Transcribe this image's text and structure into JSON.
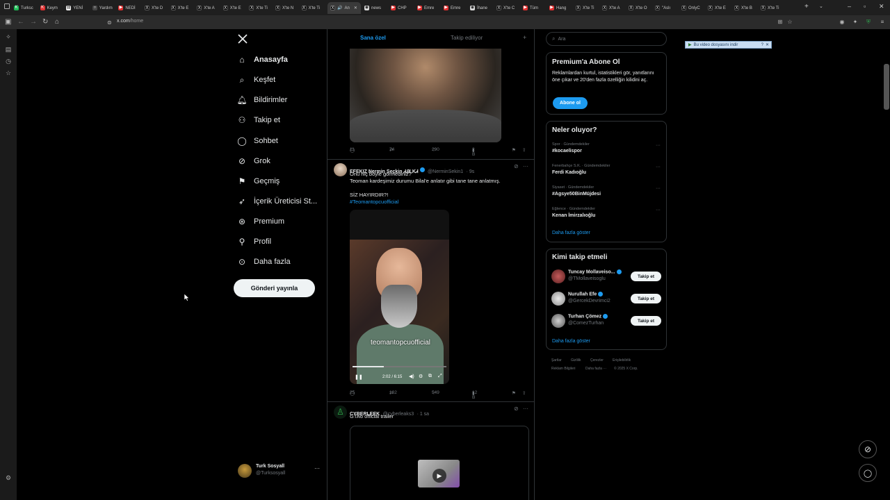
{
  "browser": {
    "tabs": [
      {
        "label": "Turksc",
        "color": "#1db954",
        "glyph": "K"
      },
      {
        "label": "Keym",
        "color": "#e03030",
        "glyph": "K"
      },
      {
        "label": "YENİ",
        "color": "#ffffff",
        "glyph": "▤"
      },
      {
        "label": "Yardım",
        "color": "#444444",
        "glyph": "○"
      },
      {
        "label": "NEDİ",
        "color": "#e03030",
        "glyph": "▶"
      },
      {
        "label": "X'te D",
        "color": "#000000",
        "glyph": "X"
      },
      {
        "label": "X'te E",
        "color": "#000000",
        "glyph": "X"
      },
      {
        "label": "X'te A",
        "color": "#000000",
        "glyph": "X"
      },
      {
        "label": "X'te E",
        "color": "#000000",
        "glyph": "X"
      },
      {
        "label": "X'te Ti",
        "color": "#000000",
        "glyph": "X"
      },
      {
        "label": "X'te N",
        "color": "#000000",
        "glyph": "X"
      },
      {
        "label": "X'te Ti",
        "color": "#000000",
        "glyph": "X"
      }
    ],
    "active_tab": "An",
    "tabs_right": [
      {
        "label": "news",
        "color": "#dddddd",
        "glyph": "◉"
      },
      {
        "label": "CHP",
        "color": "#e03030",
        "glyph": "▶"
      },
      {
        "label": "Emre",
        "color": "#e03030",
        "glyph": "▶"
      },
      {
        "label": "Emre",
        "color": "#e03030",
        "glyph": "▶"
      },
      {
        "label": "İhane",
        "color": "#dddddd",
        "glyph": "◉"
      },
      {
        "label": "X'te C",
        "color": "#000000",
        "glyph": "X"
      },
      {
        "label": "Tüm",
        "color": "#e03030",
        "glyph": "▶"
      },
      {
        "label": "Hang",
        "color": "#e03030",
        "glyph": "▶"
      },
      {
        "label": "X'te Ti",
        "color": "#000000",
        "glyph": "X"
      },
      {
        "label": "X'te A",
        "color": "#000000",
        "glyph": "X"
      },
      {
        "label": "X'te O",
        "color": "#000000",
        "glyph": "X"
      },
      {
        "label": "\"Aslı",
        "color": "#000000",
        "glyph": "X"
      },
      {
        "label": "OnlyC",
        "color": "#000000",
        "glyph": "X"
      },
      {
        "label": "X'te E",
        "color": "#000000",
        "glyph": "X"
      },
      {
        "label": "X'te B",
        "color": "#000000",
        "glyph": "X"
      },
      {
        "label": "X'te Ti",
        "color": "#000000",
        "glyph": "X"
      }
    ],
    "url_domain": "x.com",
    "url_path": "/home"
  },
  "download_bar": "Bu video dosyasını indir",
  "nav": {
    "items": [
      {
        "label": "Anasayfa",
        "icon": "home-icon"
      },
      {
        "label": "Keşfet",
        "icon": "search-icon"
      },
      {
        "label": "Bildirimler",
        "icon": "bell-icon"
      },
      {
        "label": "Takip et",
        "icon": "follow-icon"
      },
      {
        "label": "Sohbet",
        "icon": "chat-icon"
      },
      {
        "label": "Grok",
        "icon": "grok-icon"
      },
      {
        "label": "Geçmiş",
        "icon": "bookmark-icon"
      },
      {
        "label": "İçerik Üreticisi St...",
        "icon": "rocket-icon"
      },
      {
        "label": "Premium",
        "icon": "premium-icon"
      },
      {
        "label": "Profil",
        "icon": "profile-icon"
      },
      {
        "label": "Daha fazla",
        "icon": "more-circle-icon"
      }
    ],
    "post_button": "Gönderi yayınla",
    "account_name": "Turk Sosyall",
    "account_handle": "@Turksosyall"
  },
  "feed": {
    "tab_for_you": "Sana özel",
    "tab_following": "Takip ediliyor",
    "first_actions": {
      "replies": "11",
      "reposts": "74",
      "likes": "290",
      "views": "2 B"
    },
    "tweet2": {
      "name": "EFEKIZ Nermin Seçkin ᏗᎯᏞᏦᏗ",
      "handle": "@NerminSekin1",
      "time": "· 9s",
      "line1": "Onu hiç böyle görmediniz?",
      "line2": "Teoman kardeşimiz durumu Bilal'e anlatır gibi tane tane anlatmış.",
      "line3": "SİZ HAYIRDIR?!",
      "hashtag": "#Teomantopcuofficial",
      "video_watermark": "teomantopcuofficial",
      "video_time": "2:02 / 6:15",
      "video_progress": 0.33,
      "actions": {
        "replies": "25",
        "reposts": "132",
        "likes": "549",
        "views": "12 B"
      }
    },
    "tweet3": {
      "name": "CYBERLEEK",
      "handle": "@cyberleaks3",
      "time": "· 1 sa",
      "text": "GTA6 official trailer"
    }
  },
  "right": {
    "search_placeholder": "Ara",
    "premium": {
      "title": "Premium'a Abone Ol",
      "text": "Reklamlardan kurtul, istatistikleri gör, yanıtlarını öne çıkar ve 20'den fazla özelliğin kilidini aç.",
      "button": "Abone ol"
    },
    "trends": {
      "title": "Neler oluyor?",
      "items": [
        {
          "meta": "Spor · Gündemdekiler",
          "name": "#kocaelispor"
        },
        {
          "meta": "Fenerbahçe S.K. · Gündemdekiler",
          "name": "Ferdi Kadıoğlu"
        },
        {
          "meta": "Siyaset · Gündemdekiler",
          "name": "#Agsye50BinMüjdesi"
        },
        {
          "meta": "Eğlence · Gündemdekiler",
          "name": "Kenan İmirzalıoğlu"
        }
      ],
      "show_more": "Daha fazla göster"
    },
    "who_to_follow": {
      "title": "Kimi takip etmeli",
      "items": [
        {
          "name": "Tuncay Mollaveiso...",
          "handle": "@TMollaveisoglu",
          "button": "Takip et"
        },
        {
          "name": "Nurullah Efe",
          "handle": "@GercekDevrimci2",
          "button": "Takip et"
        },
        {
          "name": "Turhan Çömez",
          "handle": "@ComezTurhan",
          "button": "Takip et"
        }
      ],
      "show_more": "Daha fazla göster"
    },
    "footer": [
      "Şartlar",
      "Gizlilik",
      "Çerezler",
      "Erişilebilirlik",
      "Reklam Bilgileri",
      "Daha fazla ···",
      "© 2025 X Corp."
    ]
  },
  "colors": {
    "accent": "#1d9bf0",
    "bg": "#000000",
    "border": "#2f3336",
    "muted": "#71767b"
  }
}
